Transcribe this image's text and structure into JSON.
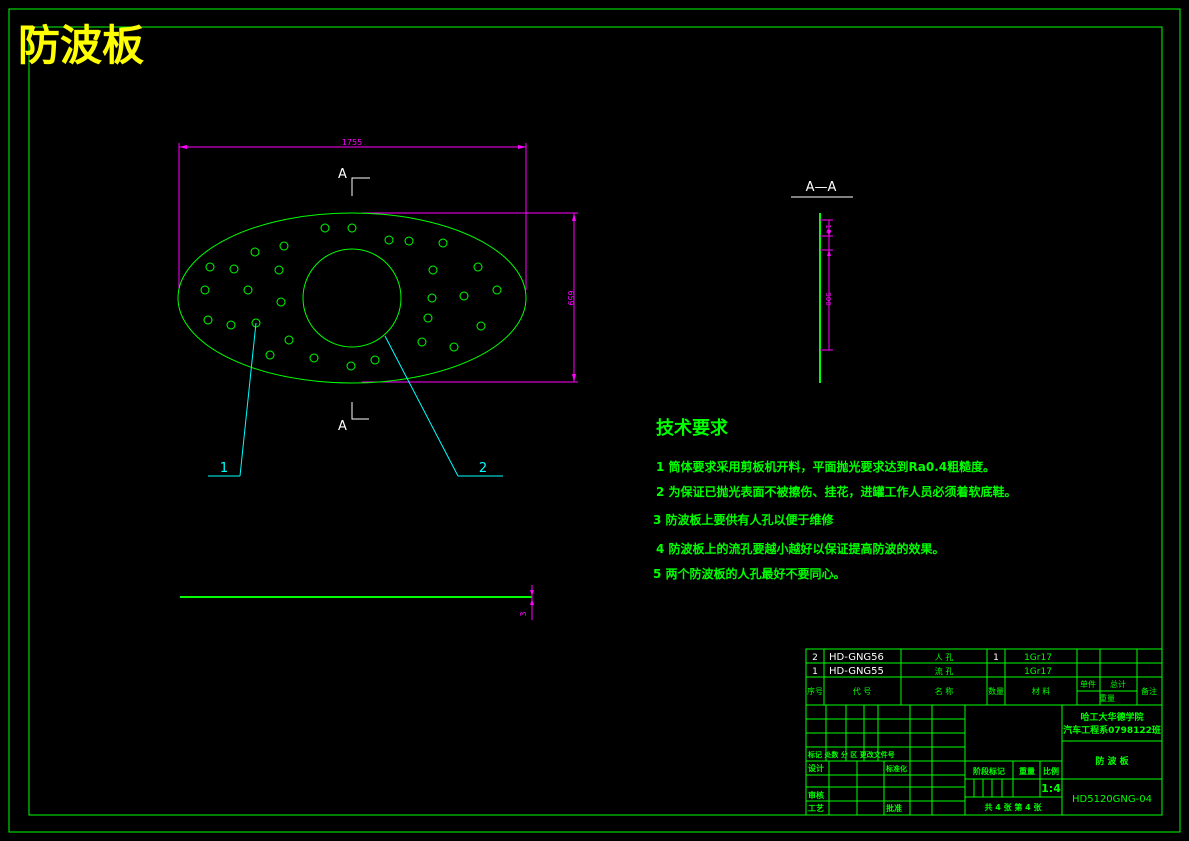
{
  "title": "防波板",
  "drawing": {
    "top_dimension": "1755",
    "right_dimension": "659",
    "section_marker": "A",
    "section_title": "A—A",
    "section_dim_small": "14",
    "section_dim_large": "500",
    "bottom_dimension": "3",
    "leader_labels": [
      "1",
      "2"
    ]
  },
  "tech_requirements": {
    "heading": "技术要求",
    "items": [
      "1   筒体要求采用剪板机开料，平面抛光要求达到Ra0.4粗糙度。",
      "2   为保证已抛光表面不被擦伤、挂花，进罐工作人员必须着软底鞋。",
      "3   防波板上要供有人孔以便于维修",
      "4   防波板上的流孔要越小越好以保证提高防波的效果。",
      "5   两个防波板的人孔最好不要同心。"
    ]
  },
  "title_block": {
    "parts": [
      {
        "no": "2",
        "code": "HD-GNG56",
        "name": "人 孔",
        "qty": "1",
        "material": "1Gr17"
      },
      {
        "no": "1",
        "code": "HD-GNG55",
        "name": "流 孔",
        "qty": "",
        "material": "1Gr17"
      }
    ],
    "header": {
      "no": "序号",
      "code": "代    号",
      "name": "名    称",
      "qty": "数量",
      "material": "材    料",
      "unit": "单件",
      "total": "总计",
      "weight": "重量",
      "remark": "备注"
    },
    "school": "哈工大华德学院",
    "dept": "汽车工程系0798122班",
    "drawing_name": "防 波 板",
    "labels": {
      "revision": "标记 处数 分 区 更改文件号",
      "design": "设计",
      "standard": "标准化",
      "review": "审核",
      "process": "工艺",
      "approve": "批准",
      "stage": "阶段标记",
      "weight": "重量",
      "scale": "比例"
    },
    "scale_value": "1:4",
    "sheets": "共 4 张   第 4 张",
    "drawing_number": "HD5120GNG-04"
  },
  "colors": {
    "border": "#00ff00",
    "outline": "#00ff00",
    "dimension": "#ff00ff",
    "leader": "#00ffff",
    "title": "#ffff00",
    "white": "#ffffff"
  }
}
